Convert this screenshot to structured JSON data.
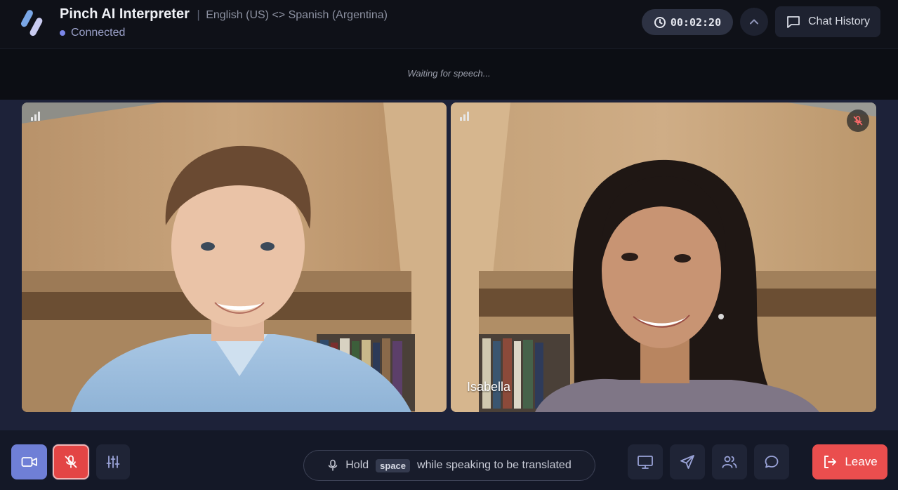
{
  "header": {
    "app_title": "Pinch AI Interpreter",
    "separator": "|",
    "language_pair": "English (US) <> Spanish (Argentina)",
    "status": "Connected",
    "timer": "00:02:20",
    "chat_history_label": "Chat History"
  },
  "caption": {
    "text": "Waiting for speech..."
  },
  "participants": [
    {
      "name": "",
      "muted": false,
      "icons": [
        "signal-icon"
      ]
    },
    {
      "name": "Isabella",
      "muted": true,
      "icons": [
        "signal-icon",
        "mic-off-icon"
      ]
    }
  ],
  "controls": {
    "hint_prefix": "Hold",
    "hint_key": "space",
    "hint_suffix": "while speaking to be translated",
    "leave_label": "Leave",
    "icons": [
      "video-camera-icon",
      "mic-off-icon",
      "sliders-icon",
      "monitor-icon",
      "send-icon",
      "people-icon",
      "chat-bubble-icon",
      "leave-icon"
    ]
  },
  "colors": {
    "accent": "#6f7fd6",
    "danger": "#e34545",
    "leave": "#ea4e4e",
    "status_dot": "#7a86e8"
  }
}
